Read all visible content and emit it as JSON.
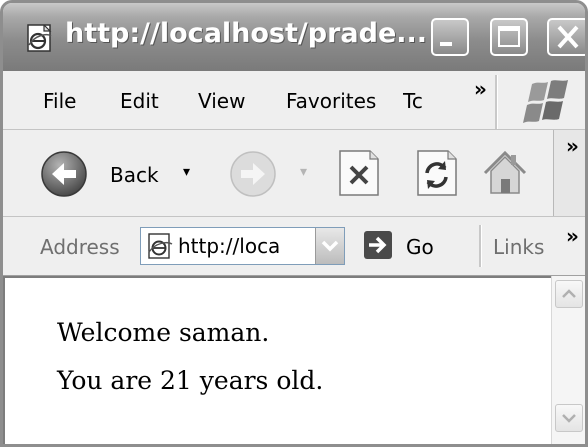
{
  "window": {
    "title": "http://localhost/prade...",
    "icons": {
      "app": "ie-page-icon",
      "minimize": "minimize-icon",
      "maximize": "maximize-icon",
      "close": "close-icon"
    }
  },
  "menubar": {
    "items": [
      "File",
      "Edit",
      "View",
      "Favorites",
      "Tc"
    ],
    "overflow": "»",
    "logo": "windows-flag-logo"
  },
  "toolbar": {
    "back_label": "Back",
    "dropdown_glyph": "▾",
    "overflow": "»",
    "icons": [
      "back-arrow-icon",
      "forward-arrow-icon",
      "stop-icon",
      "refresh-icon",
      "home-icon"
    ]
  },
  "addressbar": {
    "label": "Address",
    "url": "http://localhost/prade...",
    "url_visible": "http://loca",
    "go_label": "Go",
    "links_label": "Links",
    "overflow": "»"
  },
  "content": {
    "lines": [
      "Welcome saman.",
      "You are 21 years old."
    ]
  },
  "colors": {
    "titlebar": "#8c8c8c",
    "chrome": "#efefef",
    "content_bg": "#ffffff",
    "address_border": "#7f9db9"
  }
}
